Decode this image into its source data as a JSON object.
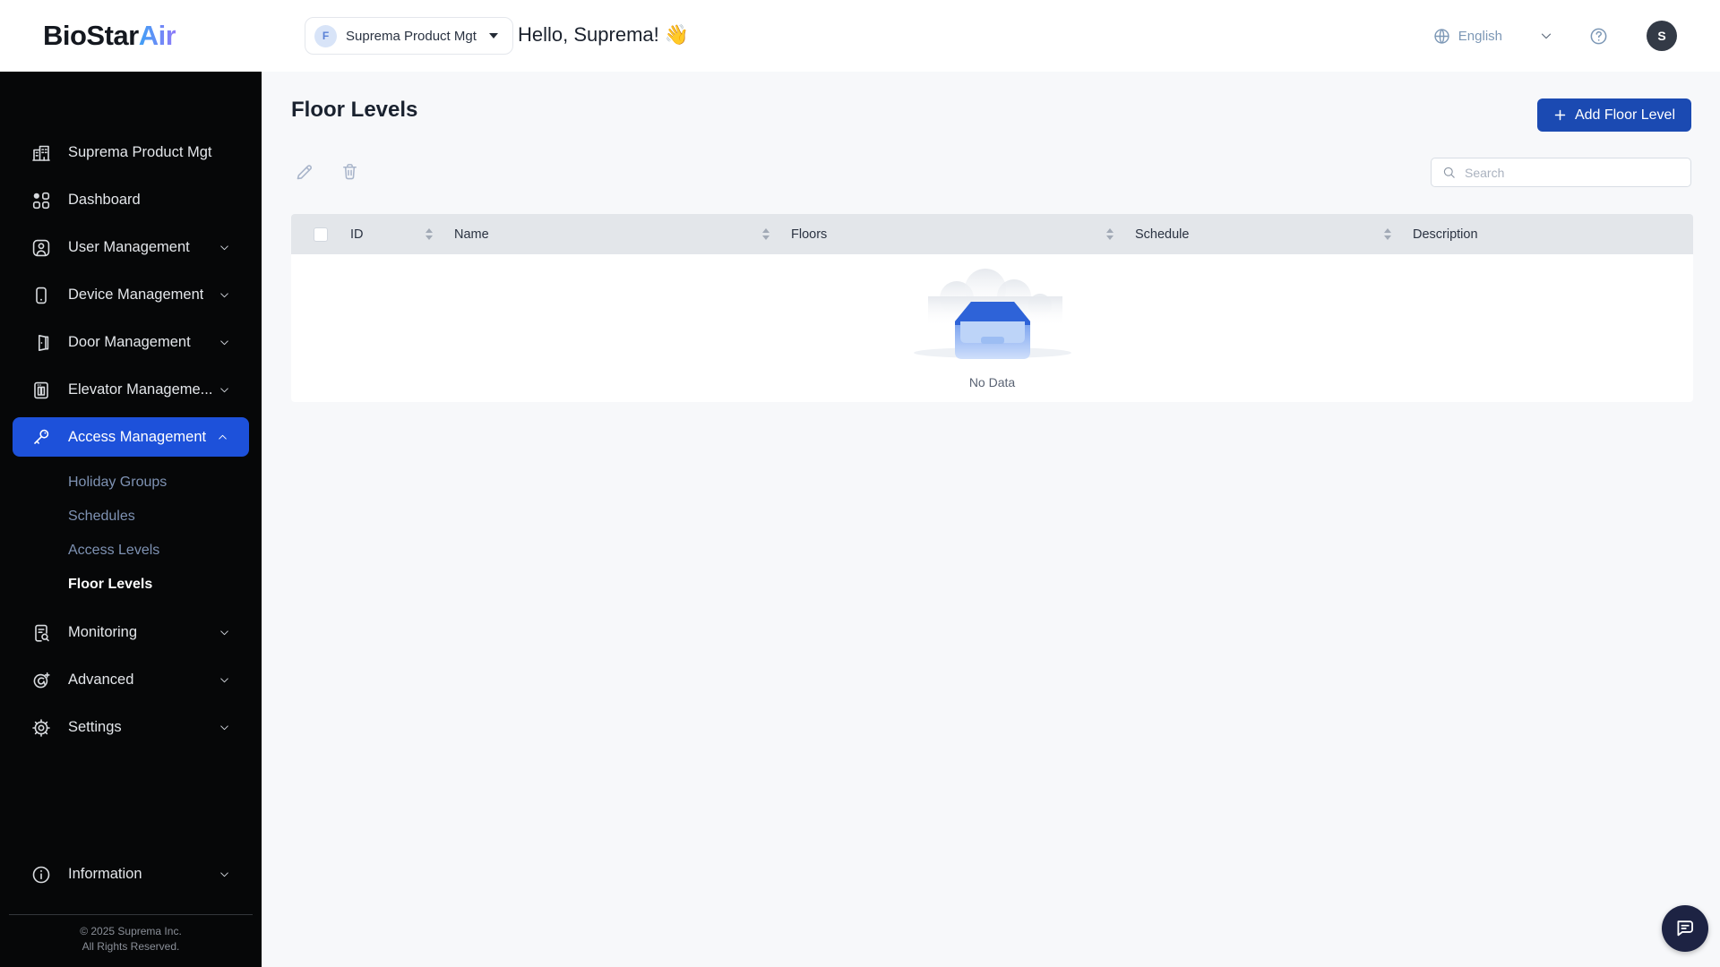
{
  "brand": {
    "text_primary": "BioStar",
    "text_accent": "Air"
  },
  "colors": {
    "sidebar_active_bg": "#1d51da",
    "add_button_bg": "#1b4ab2",
    "brand_gradient_start": "#3fa0f5",
    "brand_gradient_end": "#8f7bf8",
    "table_header_bg": "#e3e6ea",
    "chat_fab_bg": "#1d2343"
  },
  "header": {
    "workspace_badge": "F",
    "workspace_label": "Suprema Product Mgt",
    "greeting": "Hello, Suprema! 👋",
    "language_label": "English",
    "avatar_initial": "S"
  },
  "sidebar": {
    "items": [
      {
        "label": "Suprema Product Mgt"
      },
      {
        "label": "Dashboard"
      },
      {
        "label": "User Management"
      },
      {
        "label": "Device Management"
      },
      {
        "label": "Door Management"
      },
      {
        "label": "Elevator Manageme..."
      },
      {
        "label": "Access Management"
      },
      {
        "label": "Monitoring"
      },
      {
        "label": "Advanced"
      },
      {
        "label": "Settings"
      },
      {
        "label": "Information"
      }
    ],
    "access_submenu": [
      {
        "label": "Holiday Groups"
      },
      {
        "label": "Schedules"
      },
      {
        "label": "Access Levels"
      },
      {
        "label": "Floor Levels"
      }
    ],
    "footer_line1": "© 2025 Suprema Inc.",
    "footer_line2": "All Rights Reserved."
  },
  "page": {
    "title": "Floor Levels",
    "add_button_label": "Add Floor Level",
    "search_placeholder": "Search",
    "table": {
      "columns": [
        "ID",
        "Name",
        "Floors",
        "Schedule",
        "Description"
      ],
      "rows": [],
      "empty_text": "No Data"
    }
  }
}
